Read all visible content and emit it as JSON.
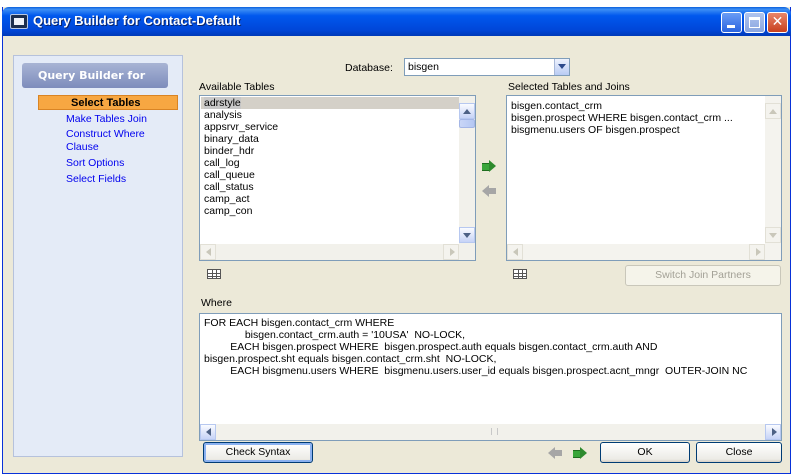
{
  "window": {
    "title": "Query Builder for Contact-Default"
  },
  "sidebar": {
    "header": "Query Builder for",
    "items": [
      {
        "label": "Select Tables",
        "active": true
      },
      {
        "label": "Make Tables Join"
      },
      {
        "label": "Construct Where Clause"
      },
      {
        "label": "Sort Options"
      },
      {
        "label": "Select Fields"
      }
    ]
  },
  "database": {
    "label": "Database:",
    "value": "bisgen"
  },
  "available": {
    "label": "Available Tables",
    "items": [
      "adrstyle",
      "analysis",
      "appsrvr_service",
      "binary_data",
      "binder_hdr",
      "call_log",
      "call_queue",
      "call_status",
      "camp_act",
      "camp_con"
    ],
    "selected_index": 0
  },
  "selected": {
    "label": "Selected Tables and Joins",
    "items": [
      "bisgen.contact_crm",
      "bisgen.prospect WHERE bisgen.contact_crm ...",
      "bisgmenu.users OF bisgen.prospect"
    ]
  },
  "buttons": {
    "switch_join": "Switch Join Partners",
    "check_syntax": "Check Syntax",
    "ok": "OK",
    "close": "Close"
  },
  "where": {
    "label": "Where",
    "lines": [
      "FOR EACH bisgen.contact_crm WHERE",
      "              bisgen.contact_crm.auth = '10USA'  NO-LOCK,",
      "         EACH bisgen.prospect WHERE  bisgen.prospect.auth equals bisgen.contact_crm.auth AND",
      "bisgen.prospect.sht equals bisgen.contact_crm.sht  NO-LOCK,",
      "         EACH bisgmenu.users WHERE  bisgmenu.users.user_id equals bisgen.prospect.acnt_mngr  OUTER-JOIN NC"
    ]
  },
  "colors": {
    "title_bar": "#0054e3",
    "active_nav": "#f7a742",
    "dialog_bg": "#ece9d8",
    "link": "#0000ee"
  }
}
